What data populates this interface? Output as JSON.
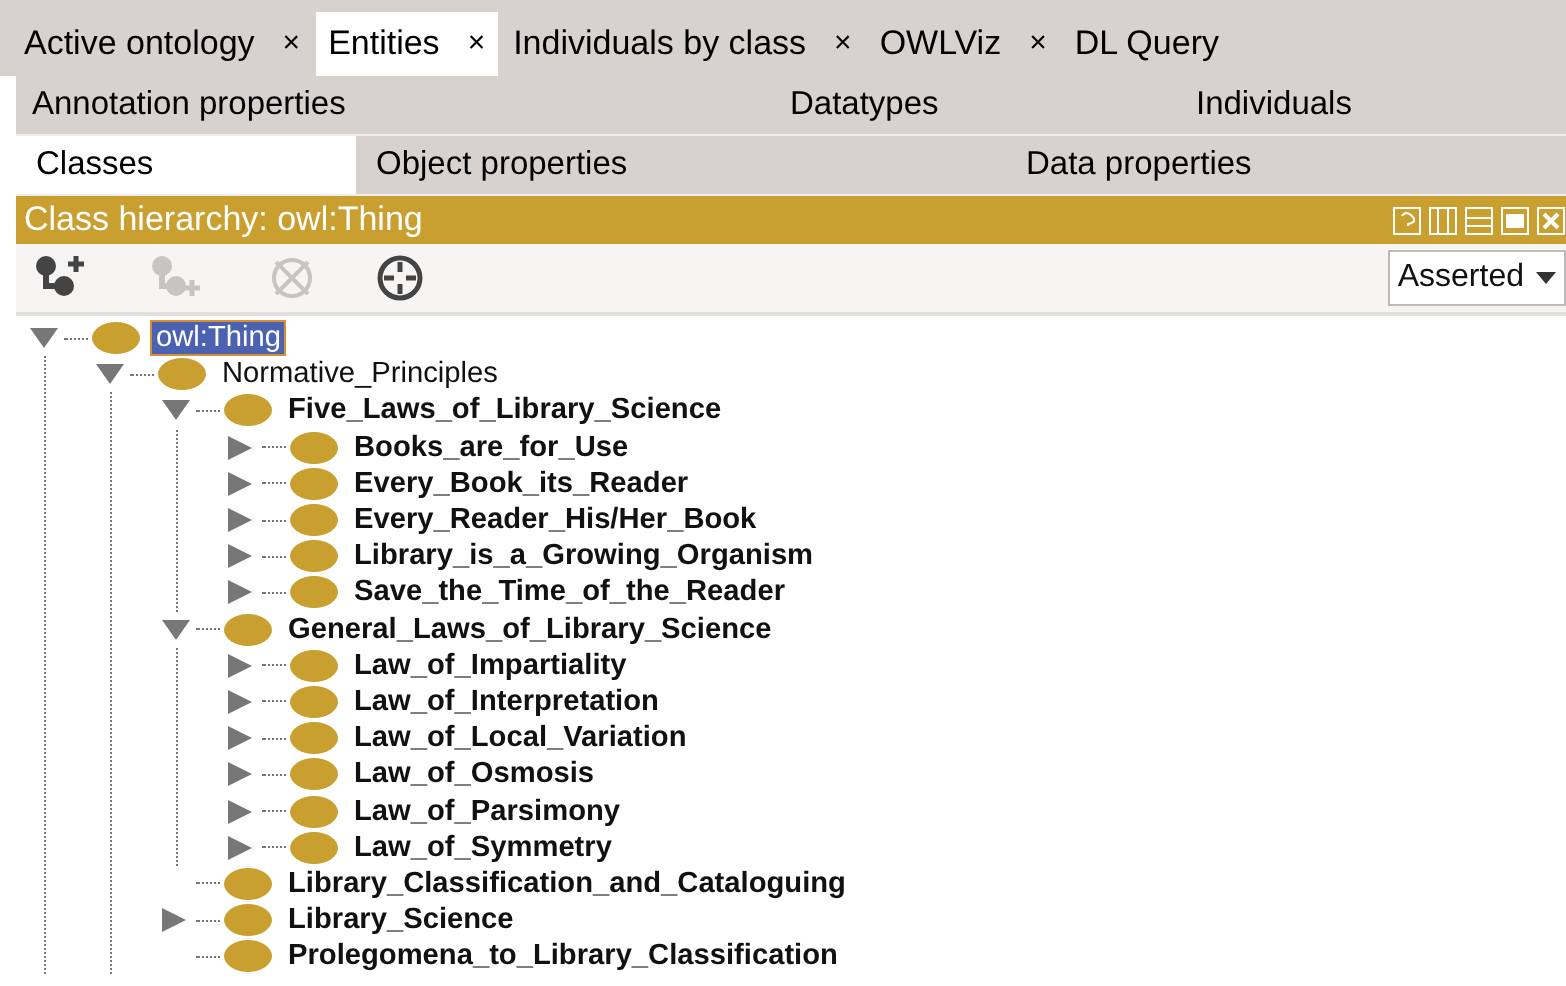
{
  "tabs": [
    {
      "label": "Active ontology",
      "close": "×",
      "selected": false
    },
    {
      "label": "Entities",
      "close": "×",
      "selected": true
    },
    {
      "label": "Individuals by class",
      "close": "×",
      "selected": false
    },
    {
      "label": "OWLViz",
      "close": "×",
      "selected": false
    },
    {
      "label": "DL Query",
      "selected": false
    }
  ],
  "subtabs": [
    [
      {
        "label": "Annotation properties",
        "selected": false
      },
      {
        "label": "Datatypes",
        "selected": false
      },
      {
        "label": "Individuals",
        "selected": false
      }
    ],
    [
      {
        "label": "Classes",
        "selected": true
      },
      {
        "label": "Object properties",
        "selected": false
      },
      {
        "label": "Data properties",
        "selected": false
      }
    ]
  ],
  "panel": {
    "title": "Class hierarchy: owl:Thing"
  },
  "toolbar": [
    {
      "kind": "add-subclass",
      "disabled": false
    },
    {
      "kind": "add-sibling",
      "disabled": true
    },
    {
      "kind": "delete",
      "disabled": true
    },
    {
      "kind": "target",
      "disabled": false
    }
  ],
  "view_select": {
    "value": "Asserted"
  },
  "tree": [
    {
      "label": "owl:Thing",
      "has_children": true,
      "expanded": true,
      "bold": false,
      "selected": true,
      "children": [
        {
          "label": "Normative_Principles",
          "has_children": true,
          "expanded": true,
          "bold": false,
          "selected": false,
          "children": [
            {
              "label": "Five_Laws_of_Library_Science",
              "has_children": true,
              "expanded": true,
              "bold": true,
              "selected": false,
              "children": [
                {
                  "label": "Books_are_for_Use",
                  "has_children": true,
                  "expanded": false,
                  "bold": true,
                  "selected": false
                },
                {
                  "label": "Every_Book_its_Reader",
                  "has_children": true,
                  "expanded": false,
                  "bold": true,
                  "selected": false
                },
                {
                  "label": "Every_Reader_His/Her_Book",
                  "has_children": true,
                  "expanded": false,
                  "bold": true,
                  "selected": false
                },
                {
                  "label": "Library_is_a_Growing_Organism",
                  "has_children": true,
                  "expanded": false,
                  "bold": true,
                  "selected": false
                },
                {
                  "label": "Save_the_Time_of_the_Reader",
                  "has_children": true,
                  "expanded": false,
                  "bold": true,
                  "selected": false
                }
              ]
            },
            {
              "label": "General_Laws_of_Library_Science",
              "has_children": true,
              "expanded": true,
              "bold": true,
              "selected": false,
              "children": [
                {
                  "label": "Law_of_Impartiality",
                  "has_children": true,
                  "expanded": false,
                  "bold": true,
                  "selected": false
                },
                {
                  "label": "Law_of_Interpretation",
                  "has_children": true,
                  "expanded": false,
                  "bold": true,
                  "selected": false
                },
                {
                  "label": "Law_of_Local_Variation",
                  "has_children": true,
                  "expanded": false,
                  "bold": true,
                  "selected": false
                },
                {
                  "label": "Law_of_Osmosis",
                  "has_children": true,
                  "expanded": false,
                  "bold": true,
                  "selected": false
                },
                {
                  "label": "Law_of_Parsimony",
                  "has_children": true,
                  "expanded": false,
                  "bold": true,
                  "selected": false
                },
                {
                  "label": "Law_of_Symmetry",
                  "has_children": true,
                  "expanded": false,
                  "bold": true,
                  "selected": false
                }
              ]
            },
            {
              "label": "Library_Classification_and_Cataloguing",
              "has_children": false,
              "bold": true,
              "selected": false
            },
            {
              "label": "Library_Science",
              "has_children": true,
              "expanded": false,
              "bold": true,
              "selected": false
            },
            {
              "label": "Prolegomena_to_Library_Classification",
              "has_children": false,
              "bold": true,
              "selected": false
            }
          ]
        }
      ]
    }
  ]
}
